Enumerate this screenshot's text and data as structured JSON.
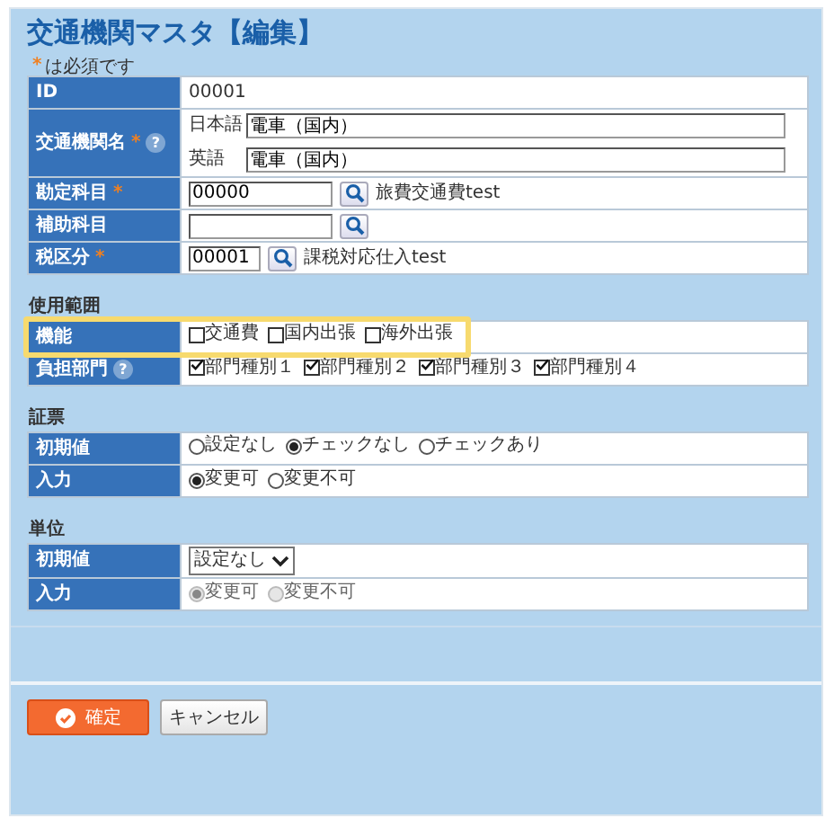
{
  "title": "交通機関マスタ【編集】",
  "required_note": {
    "mark": "*",
    "text": "は必須です"
  },
  "sections": [
    {
      "rows": [
        {
          "label": "ID",
          "kind": "text",
          "value": "00001"
        },
        {
          "label": "交通機関名",
          "required": true,
          "help": "?",
          "kind": "names",
          "entries": [
            {
              "lang": "日本語",
              "value": "電車（国内）"
            },
            {
              "lang": "英語",
              "value": "電車（国内）"
            }
          ]
        },
        {
          "label": "勘定科目",
          "required": true,
          "kind": "lookup",
          "value": "00000",
          "name": "旅費交通費test"
        },
        {
          "label": "補助科目",
          "kind": "lookup"
        },
        {
          "label": "税区分",
          "required": true,
          "kind": "short_lookup",
          "value": "00001",
          "name": "課税対応仕入test"
        }
      ]
    },
    {
      "heading": "使用範囲",
      "rows": [
        {
          "label": "機能",
          "highlighted": true,
          "kind": "checks",
          "options": [
            {
              "label": "交通費",
              "checked": false
            },
            {
              "label": "国内出張",
              "checked": false
            },
            {
              "label": "海外出張",
              "checked": false
            }
          ]
        },
        {
          "label": "負担部門",
          "help": "?",
          "kind": "checks",
          "options": [
            {
              "label": "部門種別１",
              "checked": true
            },
            {
              "label": "部門種別２",
              "checked": true
            },
            {
              "label": "部門種別３",
              "checked": true
            },
            {
              "label": "部門種別４",
              "checked": true
            }
          ]
        }
      ]
    },
    {
      "heading": "証票",
      "rows": [
        {
          "label": "初期値",
          "kind": "radios",
          "options": [
            {
              "label": "設定なし",
              "selected": false
            },
            {
              "label": "チェックなし",
              "selected": true
            },
            {
              "label": "チェックあり",
              "selected": false
            }
          ]
        },
        {
          "label": "入力",
          "kind": "radios",
          "options": [
            {
              "label": "変更可",
              "selected": true
            },
            {
              "label": "変更不可",
              "selected": false
            }
          ]
        }
      ]
    },
    {
      "heading": "単位",
      "rows": [
        {
          "label": "初期値",
          "kind": "select",
          "value": "設定なし"
        },
        {
          "label": "入力",
          "kind": "radios",
          "disabled": true,
          "options": [
            {
              "label": "変更可",
              "selected": true
            },
            {
              "label": "変更不可",
              "selected": false
            }
          ]
        }
      ]
    }
  ],
  "buttons": [
    {
      "label": "確定",
      "kind": "primary"
    },
    {
      "label": "キャンセル",
      "kind": "secondary"
    }
  ]
}
